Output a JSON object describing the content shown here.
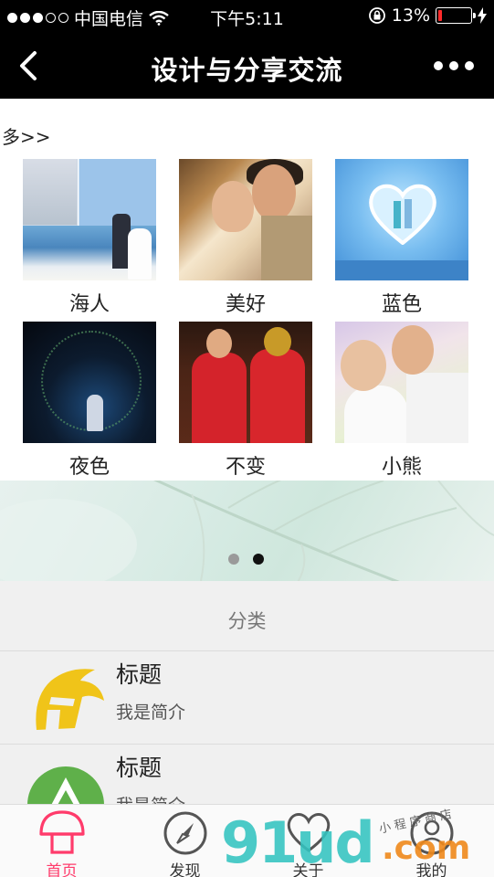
{
  "status_bar": {
    "carrier": "中国电信",
    "time": "下午5:11",
    "battery_percent": "13%",
    "battery_level": 0.13,
    "signal_bars_filled": 3,
    "signal_bars_total": 5,
    "battery_color": "#ff2a2a"
  },
  "nav": {
    "back_icon": "chevron-left-icon",
    "title": "设计与分享交流",
    "more_icon": "more-dots-icon"
  },
  "more_link": "多>>",
  "gallery": [
    {
      "label": "海人"
    },
    {
      "label": "美好"
    },
    {
      "label": "蓝色"
    },
    {
      "label": "夜色"
    },
    {
      "label": "不变"
    },
    {
      "label": "小熊"
    }
  ],
  "banner": {
    "pages_total": 2,
    "active_page": 2
  },
  "category": {
    "heading": "分类",
    "items": [
      {
        "title": "标题",
        "desc": "我是简介",
        "icon": "spartan-helmet-icon",
        "icon_color": "#f0c419"
      },
      {
        "title": "标题",
        "desc": "我是简介",
        "icon": "green-a-logo-icon",
        "icon_color": "#5fb04a"
      }
    ]
  },
  "tabbar": {
    "accent": "#ff3b6b",
    "tabs": [
      {
        "label": "首页",
        "icon": "mushroom-home-icon",
        "active": true
      },
      {
        "label": "发现",
        "icon": "compass-icon",
        "active": false
      },
      {
        "label": "关于",
        "icon": "heart-icon",
        "active": false
      },
      {
        "label": "我的",
        "icon": "profile-icon",
        "active": false
      }
    ]
  },
  "watermark": {
    "brand": "91ud",
    "domain": ".com",
    "tagline": "小程序商店"
  }
}
